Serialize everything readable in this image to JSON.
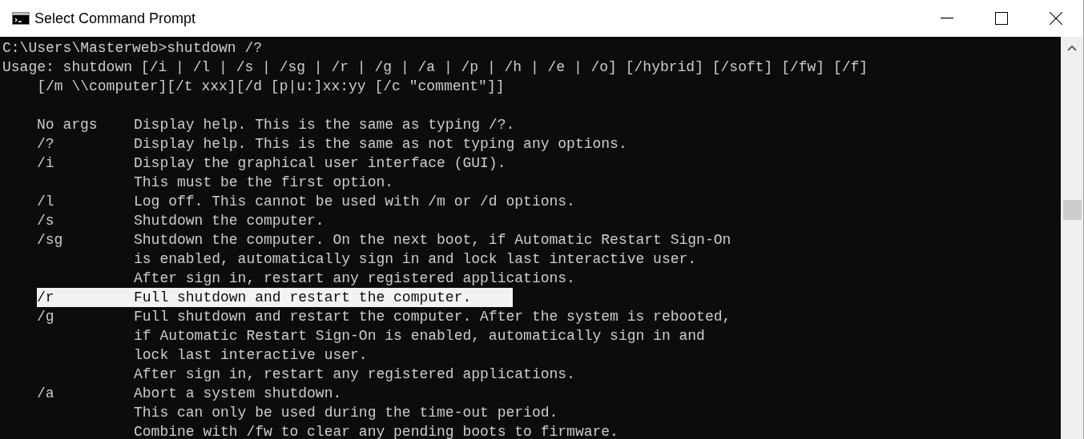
{
  "window": {
    "title": "Select Command Prompt"
  },
  "console": {
    "lines": [
      "C:\\Users\\Masterweb>shutdown /?",
      "Usage: shutdown [/i | /l | /s | /sg | /r | /g | /a | /p | /h | /e | /o] [/hybrid] [/soft] [/fw] [/f]",
      "    [/m \\\\computer][/t xxx][/d [p|u:]xx:yy [/c \"comment\"]]"
    ],
    "options": [
      {
        "option": "No args",
        "lines": [
          "Display help. This is the same as typing /?."
        ],
        "selected": false
      },
      {
        "option": "/?",
        "lines": [
          "Display help. This is the same as not typing any options."
        ],
        "selected": false
      },
      {
        "option": "/i",
        "lines": [
          "Display the graphical user interface (GUI).",
          "This must be the first option."
        ],
        "selected": false
      },
      {
        "option": "/l",
        "lines": [
          "Log off. This cannot be used with /m or /d options."
        ],
        "selected": false
      },
      {
        "option": "/s",
        "lines": [
          "Shutdown the computer."
        ],
        "selected": false
      },
      {
        "option": "/sg",
        "lines": [
          "Shutdown the computer. On the next boot, if Automatic Restart Sign-On",
          "is enabled, automatically sign in and lock last interactive user.",
          "After sign in, restart any registered applications."
        ],
        "selected": false
      },
      {
        "option": "/r",
        "lines": [
          "Full shutdown and restart the computer."
        ],
        "selected": true
      },
      {
        "option": "/g",
        "lines": [
          "Full shutdown and restart the computer. After the system is rebooted,",
          "if Automatic Restart Sign-On is enabled, automatically sign in and",
          "lock last interactive user.",
          "After sign in, restart any registered applications."
        ],
        "selected": false
      },
      {
        "option": "/a",
        "lines": [
          "Abort a system shutdown.",
          "This can only be used during the time-out period.",
          "Combine with /fw to clear any pending boots to firmware."
        ],
        "selected": false
      }
    ]
  }
}
